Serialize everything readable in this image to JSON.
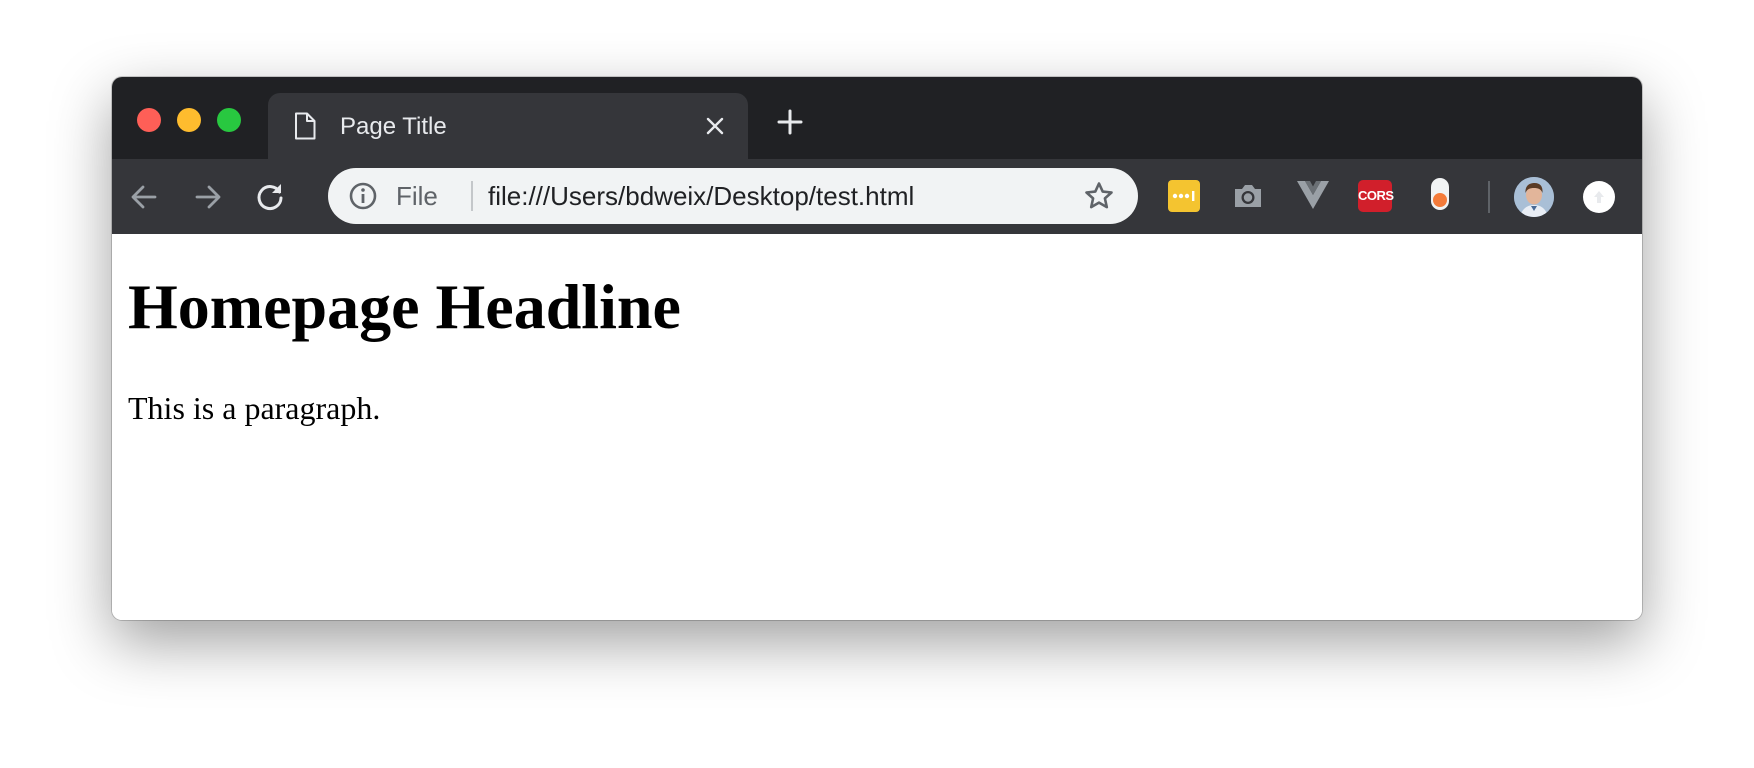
{
  "window": {
    "controls": [
      "close",
      "minimize",
      "zoom"
    ]
  },
  "tab": {
    "title": "Page Title",
    "favicon_icon": "document-icon",
    "close_icon": "close-icon"
  },
  "new_tab": {
    "icon": "plus-icon"
  },
  "toolbar": {
    "back_icon": "arrow-left-icon",
    "forward_icon": "arrow-right-icon",
    "reload_icon": "reload-icon"
  },
  "omnibox": {
    "info_icon": "info-icon",
    "scheme_label": "File",
    "url": "file:///Users/bdweix/Desktop/test.html",
    "bookmark_icon": "star-icon"
  },
  "extensions": [
    {
      "name": "dots-extension",
      "icon": "dots-icon",
      "color": "#f4c430"
    },
    {
      "name": "camera-extension",
      "icon": "camera-icon"
    },
    {
      "name": "vue-extension",
      "icon": "vue-icon"
    },
    {
      "name": "cors-extension",
      "label": "CORS",
      "color": "#d11f2b"
    },
    {
      "name": "toggle-extension",
      "icon": "toggle-icon",
      "color": "#f47b3a"
    }
  ],
  "profile": {
    "icon": "avatar-icon"
  },
  "update": {
    "icon": "update-icon"
  },
  "page": {
    "headline": "Homepage Headline",
    "paragraph": "This is a paragraph."
  },
  "colors": {
    "tabstrip": "#202124",
    "toolbar": "#35363a",
    "omnibox": "#f1f3f4",
    "close_button": "#fe5f57",
    "minimize_button": "#febc2e",
    "zoom_button": "#28c840"
  }
}
